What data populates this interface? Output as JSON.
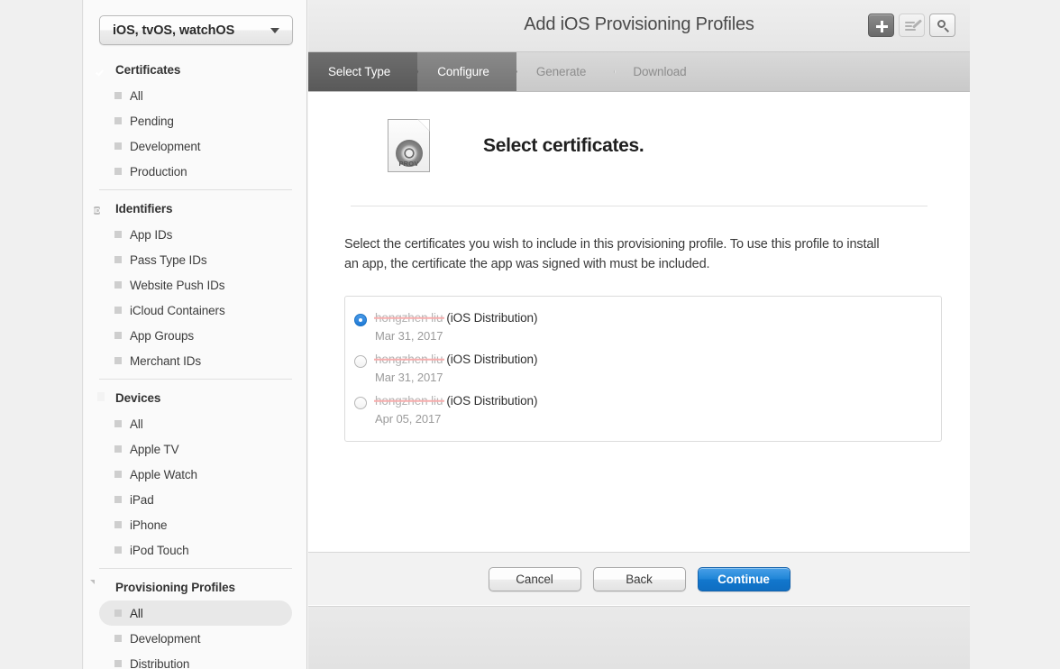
{
  "sidebar": {
    "platform_select": {
      "value": "iOS, tvOS, watchOS",
      "caret_icon": "chevron-down-icon"
    },
    "sections": [
      {
        "title": "Certificates",
        "icon": "seal-check-icon",
        "items": [
          {
            "label": "All",
            "selected": false
          },
          {
            "label": "Pending",
            "selected": false
          },
          {
            "label": "Development",
            "selected": false
          },
          {
            "label": "Production",
            "selected": false
          }
        ]
      },
      {
        "title": "Identifiers",
        "icon": "id-badge-icon",
        "icon_text": "ID",
        "items": [
          {
            "label": "App IDs",
            "selected": false
          },
          {
            "label": "Pass Type IDs",
            "selected": false
          },
          {
            "label": "Website Push IDs",
            "selected": false
          },
          {
            "label": "iCloud Containers",
            "selected": false
          },
          {
            "label": "App Groups",
            "selected": false
          },
          {
            "label": "Merchant IDs",
            "selected": false
          }
        ]
      },
      {
        "title": "Devices",
        "icon": "device-phone-icon",
        "items": [
          {
            "label": "All",
            "selected": false
          },
          {
            "label": "Apple TV",
            "selected": false
          },
          {
            "label": "Apple Watch",
            "selected": false
          },
          {
            "label": "iPad",
            "selected": false
          },
          {
            "label": "iPhone",
            "selected": false
          },
          {
            "label": "iPod Touch",
            "selected": false
          }
        ]
      },
      {
        "title": "Provisioning Profiles",
        "icon": "document-icon",
        "items": [
          {
            "label": "All",
            "selected": true
          },
          {
            "label": "Development",
            "selected": false
          },
          {
            "label": "Distribution",
            "selected": false
          }
        ]
      }
    ]
  },
  "header": {
    "title": "Add iOS Provisioning Profiles",
    "buttons": [
      {
        "name": "add-button",
        "icon": "plus-icon",
        "state": "active"
      },
      {
        "name": "edit-button",
        "icon": "pencil-edit-icon",
        "state": "disabled"
      },
      {
        "name": "search-button",
        "icon": "search-icon",
        "state": "normal"
      }
    ]
  },
  "wizard": {
    "steps": [
      {
        "label": "Select Type",
        "state": "done"
      },
      {
        "label": "Configure",
        "state": "current"
      },
      {
        "label": "Generate",
        "state": "todo"
      },
      {
        "label": "Download",
        "state": "todo"
      }
    ]
  },
  "content": {
    "icon_label": "PROV",
    "icon_name": "provisioning-profile-icon",
    "heading": "Select certificates.",
    "description": "Select the certificates you wish to include in this provisioning profile. To use this profile to install an app, the certificate the app was signed with must be included.",
    "certificates": [
      {
        "name": "hongzhen liu",
        "redacted": true,
        "type": "(iOS Distribution)",
        "date": "Mar 31, 2017",
        "selected": true
      },
      {
        "name": "hongzhen liu",
        "redacted": true,
        "type": "(iOS Distribution)",
        "date": "Mar 31, 2017",
        "selected": false
      },
      {
        "name": "hongzhen liu",
        "redacted": true,
        "type": "(iOS Distribution)",
        "date": "Apr 05, 2017",
        "selected": false
      }
    ]
  },
  "footer": {
    "cancel_label": "Cancel",
    "back_label": "Back",
    "continue_label": "Continue"
  },
  "colors": {
    "accent": "#1277cd",
    "redaction": "#ec2b2b",
    "radio_selected": "#1f7ad6",
    "wizard_done": "#595959",
    "wizard_current": "#757575"
  }
}
